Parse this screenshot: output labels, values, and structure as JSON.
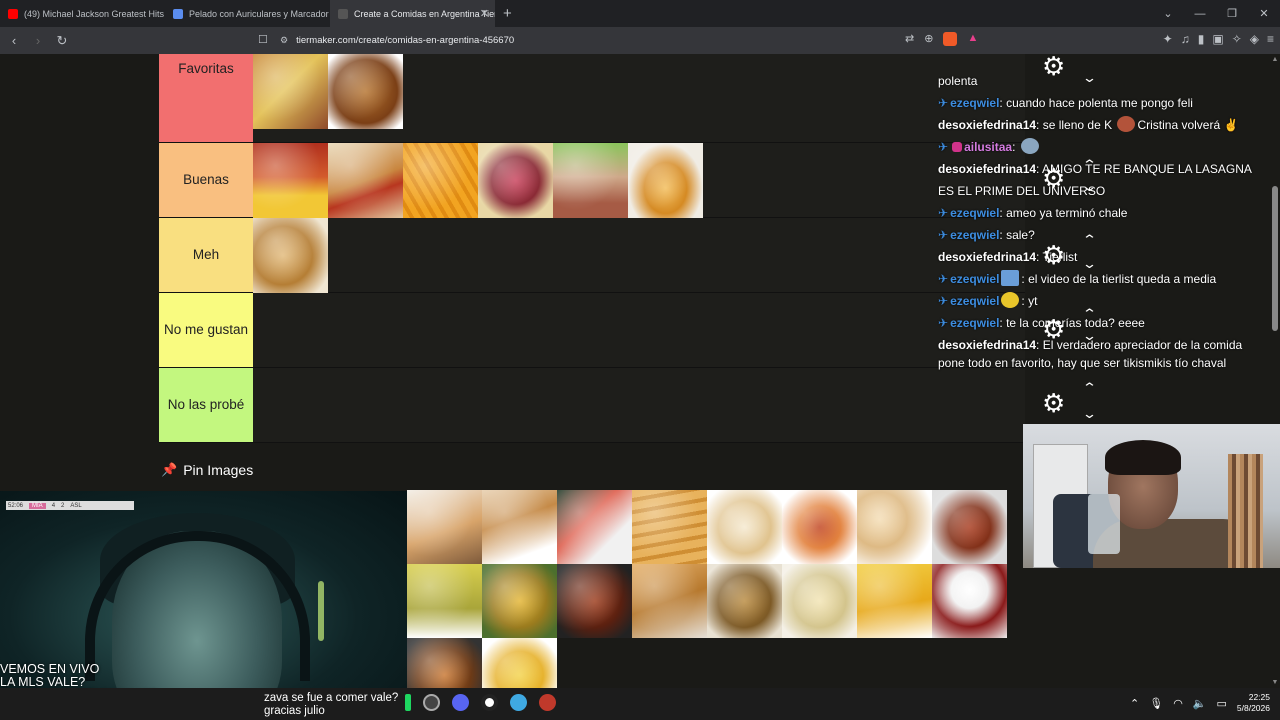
{
  "browser": {
    "tabs": [
      {
        "title": "(49) Michael Jackson Greatest Hits",
        "fav_color": "#ff0000",
        "active": false
      },
      {
        "title": "Pelado con Auriculares y Marcador",
        "fav_color": "#5b8def",
        "active": false
      },
      {
        "title": "Create a Comidas en Argentina Tier List",
        "fav_color": "#444444",
        "active": true
      }
    ],
    "url": "tiermaker.com/create/comidas-en-argentina-456670"
  },
  "tiers": [
    {
      "label": "Favoritas",
      "color": "#f26f6f",
      "items": [
        "tacos",
        "chicken-drumsticks"
      ]
    },
    {
      "label": "Buenas",
      "color": "#f9bf80",
      "items": [
        "polenta-con-salsa",
        "pancho",
        "papas-fritas",
        "picada",
        "matambre",
        "flan"
      ]
    },
    {
      "label": "Meh",
      "color": "#f9df80",
      "items": [
        "medialunas"
      ]
    },
    {
      "label": "No me gustan",
      "color": "#f9fb80",
      "items": []
    },
    {
      "label": "No las probé",
      "color": "#c3f77f",
      "items": []
    }
  ],
  "pin_images": {
    "label": "Pin Images"
  },
  "chat": [
    {
      "user": "",
      "text": "polenta",
      "pinned": false
    },
    {
      "user": "ezeqwiel",
      "text": ": cuando hace polenta me pongo feli",
      "pinned": true
    },
    {
      "user": "desoxiefedrina14",
      "text": ": se lleno de K",
      "tail": "Cristina volverá ✌",
      "pinned": false
    },
    {
      "user": "ailusitaa",
      "text": ":",
      "pinned": true
    },
    {
      "user": "desoxiefedrina14",
      "text": ": AMIGO TE RE BANQUE LA LASAGNA ES EL PRIME DEL UNIVERSO",
      "pinned": false
    },
    {
      "user": "ezeqwiel",
      "text": ": ameo ya terminó chale",
      "pinned": true
    },
    {
      "user": "ezeqwiel",
      "text": ": sale?",
      "pinned": true
    },
    {
      "user": "desoxiefedrina14",
      "text": ": Tierlist",
      "pinned": false
    },
    {
      "user": "ezeqwiel",
      "text": ": el video de la tierlist queda a media",
      "pinned": true
    },
    {
      "user": "ezeqwiel",
      "text": ": yt",
      "pinned": true
    },
    {
      "user": "ezeqwiel",
      "text": ": te la comerías toda? eeee",
      "pinned": true
    },
    {
      "user": "desoxiefedrina14",
      "text": ": El verdadero apreciador de la comida pone todo en favorito, hay que ser tikismikis tío chaval",
      "pinned": false
    }
  ],
  "stream_left": {
    "score": {
      "team1": "MIA",
      "s1": "4",
      "s2": "2",
      "team2": "ASL",
      "time": "52:06"
    },
    "overlay": "VEMOS EN VIVO\nLA MLS VALE?\nINTER MIAMI VS SAN LUIS\nAGUANTE MESSI CAMPEON DEL MUNDO"
  },
  "taskbar": {
    "ticker": "zava se fue a comer vale?\ngracias julio",
    "time": "22:25",
    "date": "5/8/2026"
  },
  "colors": {
    "accent": "#e84d6a",
    "chat_user": "#3d8de0"
  }
}
